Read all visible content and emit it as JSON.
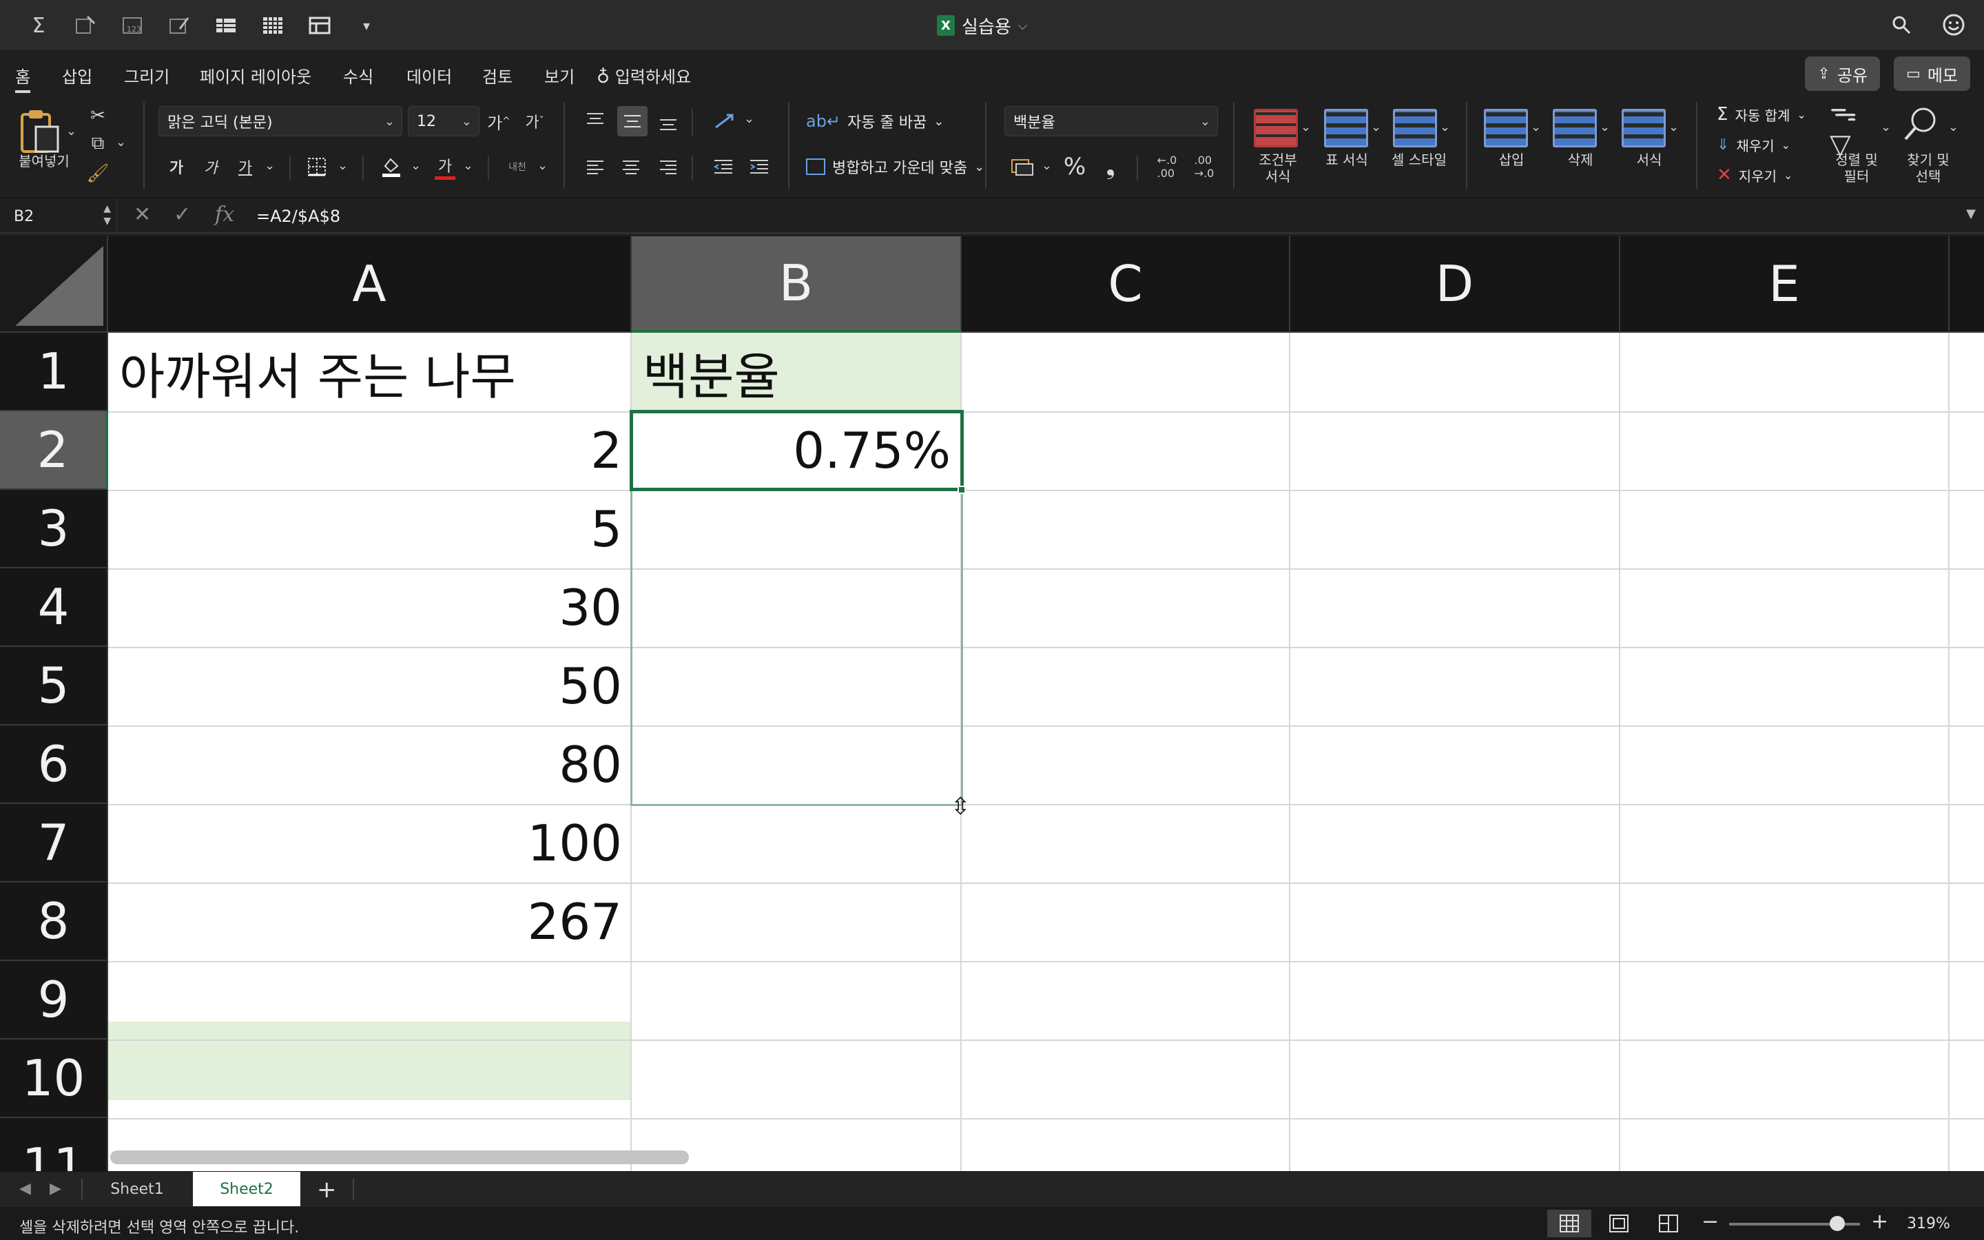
{
  "title_bar": {
    "doc_title": "실습용",
    "doc_chevron": "⌵",
    "quick_access": [
      "sum-icon",
      "format-icon",
      "number-format-icon",
      "style-icon",
      "table-icon",
      "grid-icon",
      "freeze-icon",
      "more-icon"
    ]
  },
  "tabs": [
    "홈",
    "삽입",
    "그리기",
    "페이지 레이아웃",
    "수식",
    "데이터",
    "검토",
    "보기"
  ],
  "tell_me": "입력하세요",
  "share_label": "공유",
  "comments_label": "메모",
  "ribbon": {
    "paste_label": "붙여넣기",
    "font_name": "맑은 고딕 (본문)",
    "font_size": "12",
    "grow_font": "가",
    "shrink_font": "가",
    "bold": "가",
    "italic": "가",
    "underline": "가",
    "font_color_glyph": "가",
    "phonetic": "내천",
    "wrap_text": "자동 줄 바꿈",
    "merge_center": "병합하고 가운데 맞춤",
    "number_format": "백분율",
    "percent": "%",
    "comma": "❟",
    "conditional_format": [
      "조건부",
      "서식"
    ],
    "format_table": "표 서식",
    "cell_styles": "셀 스타일",
    "insert": "삽입",
    "delete": "삭제",
    "format": "서식",
    "autosum": "자동 합계",
    "fill": "채우기",
    "clear": "지우기",
    "sort_filter": [
      "정렬 및",
      "필터"
    ],
    "find_select": [
      "찾기 및",
      "선택"
    ],
    "colors": {
      "font_red": "#e02020",
      "fill_white": "#ffffff"
    }
  },
  "formula_bar": {
    "name_box": "B2",
    "formula": "=A2/$A$8",
    "fx": "fx"
  },
  "sheet": {
    "columns": [
      "A",
      "B",
      "C",
      "D",
      "E"
    ],
    "rows": [
      "1",
      "2",
      "3",
      "4",
      "5",
      "6",
      "7",
      "8",
      "9",
      "10",
      "11"
    ],
    "cells": {
      "A1": "아까워서 주는 나무",
      "B1": "백분율",
      "A2": "2",
      "B2": "0.75%",
      "A3": "5",
      "A4": "30",
      "A5": "50",
      "A6": "80",
      "A7": "100",
      "A8": "267"
    },
    "active_cell": "B2",
    "selection_range": "B2:B7",
    "highlight_color": "#e2efda",
    "accent_color": "#1e7145"
  },
  "sheet_tabs": [
    "Sheet1",
    "Sheet2"
  ],
  "active_sheet": "Sheet2",
  "status": {
    "message": "셀을 삭제하려면 선택 영역 안쪽으로 끕니다.",
    "zoom": "319%"
  }
}
